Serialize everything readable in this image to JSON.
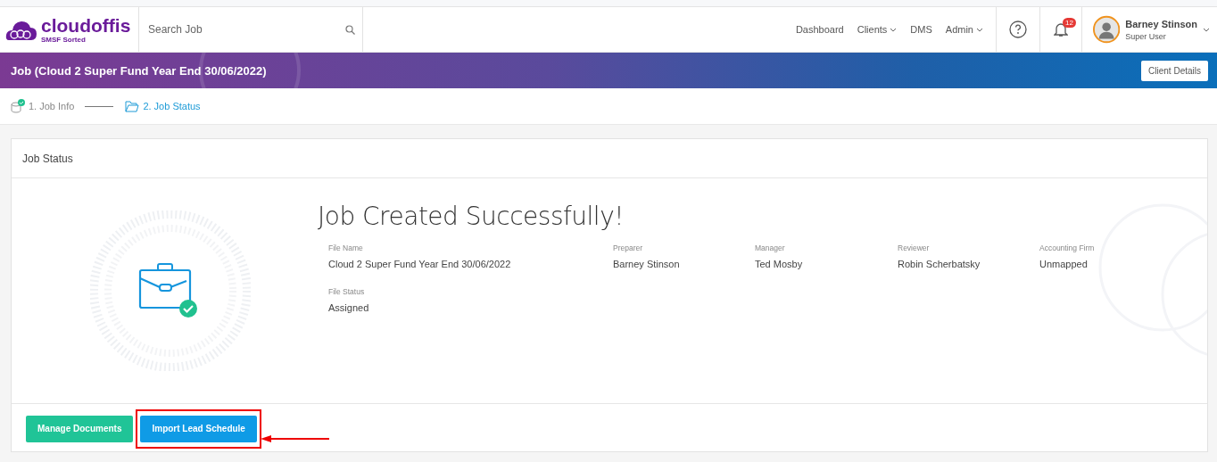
{
  "header": {
    "logo": {
      "name": "cloudoffis",
      "tagline": "SMSF Sorted"
    },
    "search": {
      "placeholder": "Search Job"
    },
    "nav": [
      {
        "label": "Dashboard",
        "dropdown": false
      },
      {
        "label": "Clients",
        "dropdown": true
      },
      {
        "label": "DMS",
        "dropdown": false
      },
      {
        "label": "Admin",
        "dropdown": true
      }
    ],
    "notifications": "12",
    "user": {
      "name": "Barney Stinson",
      "role": "Super User"
    }
  },
  "banner": {
    "title": "Job (Cloud 2 Super Fund Year End 30/06/2022)",
    "button": "Client Details"
  },
  "steps": [
    {
      "label": "1. Job Info",
      "selected": false,
      "completed": true
    },
    {
      "label": "2. Job Status",
      "selected": true,
      "completed": false
    }
  ],
  "card": {
    "title": "Job Status",
    "heading": "Job Created Successfully!",
    "fields": [
      {
        "label": "File Name",
        "value": "Cloud 2 Super Fund Year End 30/06/2022"
      },
      {
        "label": "Preparer",
        "value": "Barney Stinson"
      },
      {
        "label": "Manager",
        "value": "Ted Mosby"
      },
      {
        "label": "Reviewer",
        "value": "Robin Scherbatsky"
      },
      {
        "label": "Accounting Firm",
        "value": "Unmapped"
      },
      {
        "label": "File Status",
        "value": "Assigned"
      }
    ],
    "buttons": [
      {
        "label": "Manage Documents",
        "kind": "green",
        "highlighted": false
      },
      {
        "label": "Import Lead Schedule",
        "kind": "blue",
        "highlighted": true
      }
    ]
  }
}
